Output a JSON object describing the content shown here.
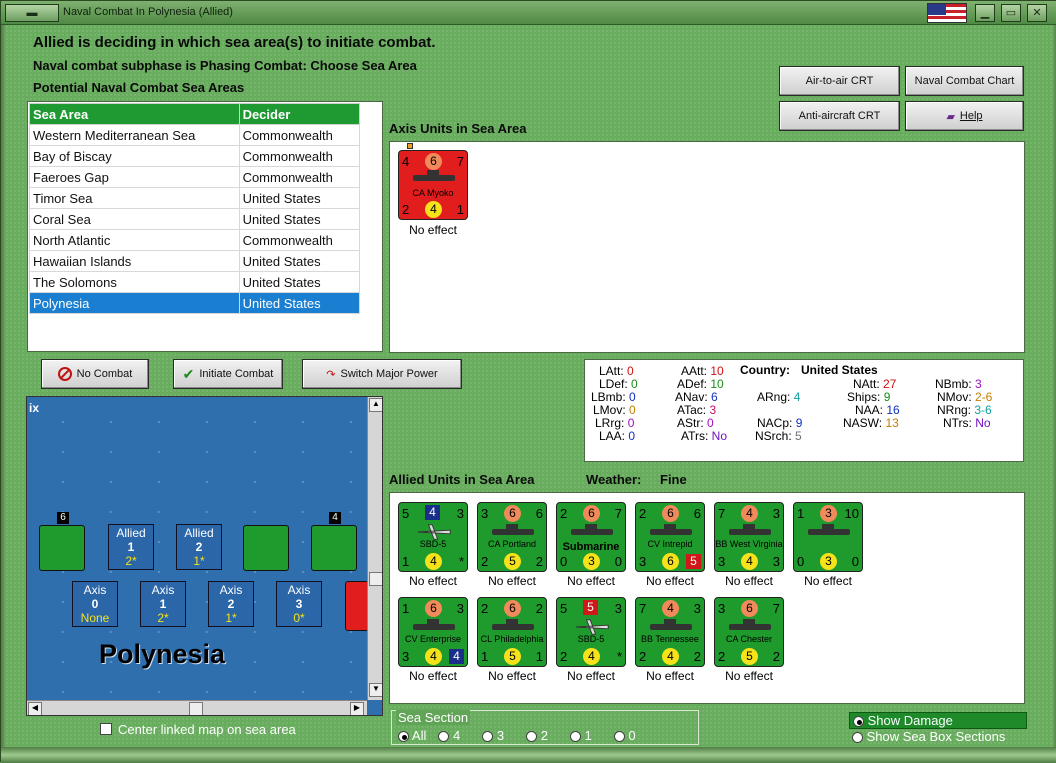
{
  "window": {
    "title": "Naval Combat In Polynesia (Allied)"
  },
  "header": {
    "line1": "Allied is deciding in which sea area(s) to initiate combat.",
    "line2": "Naval combat subphase is Phasing Combat: Choose Sea Area",
    "line3": "Potential Naval Combat Sea Areas"
  },
  "buttons": {
    "air_to_air": "Air-to-air CRT",
    "naval_chart": "Naval Combat Chart",
    "anti_aircraft": "Anti-aircraft CRT",
    "help": "Help",
    "no_combat": "No Combat",
    "initiate": "Initiate Combat",
    "switch_power": "Switch Major Power"
  },
  "sea_table": {
    "headers": [
      "Sea Area",
      "Decider"
    ],
    "rows": [
      [
        "Western Mediterranean Sea",
        "Commonwealth"
      ],
      [
        "Bay of Biscay",
        "Commonwealth"
      ],
      [
        "Faeroes Gap",
        "Commonwealth"
      ],
      [
        "Timor Sea",
        "United States"
      ],
      [
        "Coral Sea",
        "United States"
      ],
      [
        "North Atlantic",
        "Commonwealth"
      ],
      [
        "Hawaiian Islands",
        "United States"
      ],
      [
        "The Solomons",
        "United States"
      ],
      [
        "Polynesia",
        "United States"
      ]
    ]
  },
  "axis_section": {
    "title": "Axis Units in Sea Area",
    "units": [
      {
        "name": "CA Myoko",
        "tl": "4",
        "tc": "6",
        "tr": "7",
        "bl": "2",
        "bc": "4",
        "br": "1",
        "effect": "No effect"
      }
    ]
  },
  "stats": {
    "country_label": "Country:",
    "country": "United States",
    "items": [
      {
        "k": "LAtt:",
        "v": "0",
        "c": "#d01010"
      },
      {
        "k": "LDef:",
        "v": "0",
        "c": "#1a8a1a"
      },
      {
        "k": "LBmb:",
        "v": "0",
        "c": "#1030c0"
      },
      {
        "k": "LMov:",
        "v": "0",
        "c": "#c08000"
      },
      {
        "k": "LRrg:",
        "v": "0",
        "c": "#a010c0"
      },
      {
        "k": "LAA:",
        "v": "0",
        "c": "#1030c0"
      },
      {
        "k": "AAtt:",
        "v": "10",
        "c": "#d01010"
      },
      {
        "k": "ADef:",
        "v": "10",
        "c": "#1a8a1a"
      },
      {
        "k": "ANav:",
        "v": "6",
        "c": "#1030c0"
      },
      {
        "k": "ATac:",
        "v": "3",
        "c": "#c01060"
      },
      {
        "k": "AStr:",
        "v": "0",
        "c": "#a010c0"
      },
      {
        "k": "ATrs:",
        "v": "No",
        "c": "#7010c0"
      },
      {
        "k": "ARng:",
        "v": "4",
        "c": "#10a0a0"
      },
      {
        "k": "NACp:",
        "v": "9",
        "c": "#1030c0"
      },
      {
        "k": "NSrch:",
        "v": "5",
        "c": "#707070"
      },
      {
        "k": "NAtt:",
        "v": "27",
        "c": "#d01010"
      },
      {
        "k": "Ships:",
        "v": "9",
        "c": "#1a8a1a"
      },
      {
        "k": "NAA:",
        "v": "16",
        "c": "#1030c0"
      },
      {
        "k": "NASW:",
        "v": "13",
        "c": "#c08000"
      },
      {
        "k": "NBmb:",
        "v": "3",
        "c": "#a010c0"
      },
      {
        "k": "NMov:",
        "v": "2-6",
        "c": "#c08000"
      },
      {
        "k": "NRng:",
        "v": "3-6",
        "c": "#10a0a0"
      },
      {
        "k": "NTrs:",
        "v": "No",
        "c": "#7010c0"
      }
    ]
  },
  "allied_section": {
    "title": "Allied Units in Sea Area",
    "weather_label": "Weather:",
    "weather": "Fine",
    "units": [
      {
        "name": "SBD-5",
        "tl": "5",
        "tc": "4",
        "tr": "3",
        "bl": "1",
        "bc": "4",
        "br": "*",
        "effect": "No effect",
        "kind": "plane"
      },
      {
        "name": "CA Portland",
        "tl": "3",
        "tc": "6",
        "tr": "6",
        "bl": "2",
        "bc": "5",
        "br": "2",
        "effect": "No effect",
        "kind": "ship"
      },
      {
        "name": "Submarine",
        "tl": "2",
        "tc": "6",
        "tr": "7",
        "bl": "0",
        "bc": "3",
        "br": "0",
        "effect": "No effect",
        "kind": "sub"
      },
      {
        "name": "CV Intrepid",
        "tl": "2",
        "tc": "6",
        "tr": "6",
        "bl": "3",
        "bc": "6",
        "br": "5",
        "effect": "No effect",
        "kind": "ship"
      },
      {
        "name": "BB West Virginia",
        "tl": "7",
        "tc": "4",
        "tr": "3",
        "bl": "3",
        "bc": "4",
        "br": "3",
        "effect": "No effect",
        "kind": "ship"
      },
      {
        "name": "",
        "tl": "1",
        "tc": "3",
        "tr": "10",
        "bl": "0",
        "bc": "3",
        "br": "0",
        "effect": "No effect",
        "kind": "ship"
      },
      {
        "name": "CV Enterprise",
        "tl": "1",
        "tc": "6",
        "tr": "3",
        "bl": "3",
        "bc": "4",
        "br": "4",
        "effect": "No effect",
        "kind": "ship"
      },
      {
        "name": "CL Philadelphia",
        "tl": "2",
        "tc": "6",
        "tr": "2",
        "bl": "1",
        "bc": "5",
        "br": "1",
        "effect": "No effect",
        "kind": "ship"
      },
      {
        "name": "SBD-5",
        "tl": "5",
        "tc": "5",
        "tr": "3",
        "bl": "2",
        "bc": "4",
        "br": "*",
        "effect": "No effect",
        "kind": "plane"
      },
      {
        "name": "BB Tennessee",
        "tl": "7",
        "tc": "4",
        "tr": "3",
        "bl": "2",
        "bc": "4",
        "br": "2",
        "effect": "No effect",
        "kind": "ship"
      },
      {
        "name": "CA Chester",
        "tl": "3",
        "tc": "6",
        "tr": "7",
        "bl": "2",
        "bc": "5",
        "br": "2",
        "effect": "No effect",
        "kind": "ship"
      }
    ]
  },
  "map": {
    "region": "Polynesia",
    "corner": "ix",
    "allied_boxes": [
      {
        "side": "Allied",
        "num": "1",
        "val": "2*"
      },
      {
        "side": "Allied",
        "num": "2",
        "val": "1*"
      }
    ],
    "axis_boxes": [
      {
        "side": "Axis",
        "num": "0",
        "val": "None"
      },
      {
        "side": "Axis",
        "num": "1",
        "val": "2*"
      },
      {
        "side": "Axis",
        "num": "2",
        "val": "1*"
      },
      {
        "side": "Axis",
        "num": "3",
        "val": "0*"
      }
    ],
    "stack_counts": [
      "6",
      "4"
    ]
  },
  "bottom": {
    "center_map": "Center linked map on sea area",
    "sea_section_title": "Sea Section",
    "sections": [
      "All",
      "4",
      "3",
      "2",
      "1",
      "0"
    ],
    "show_damage": "Show Damage",
    "show_boxes": "Show Sea Box Sections"
  }
}
